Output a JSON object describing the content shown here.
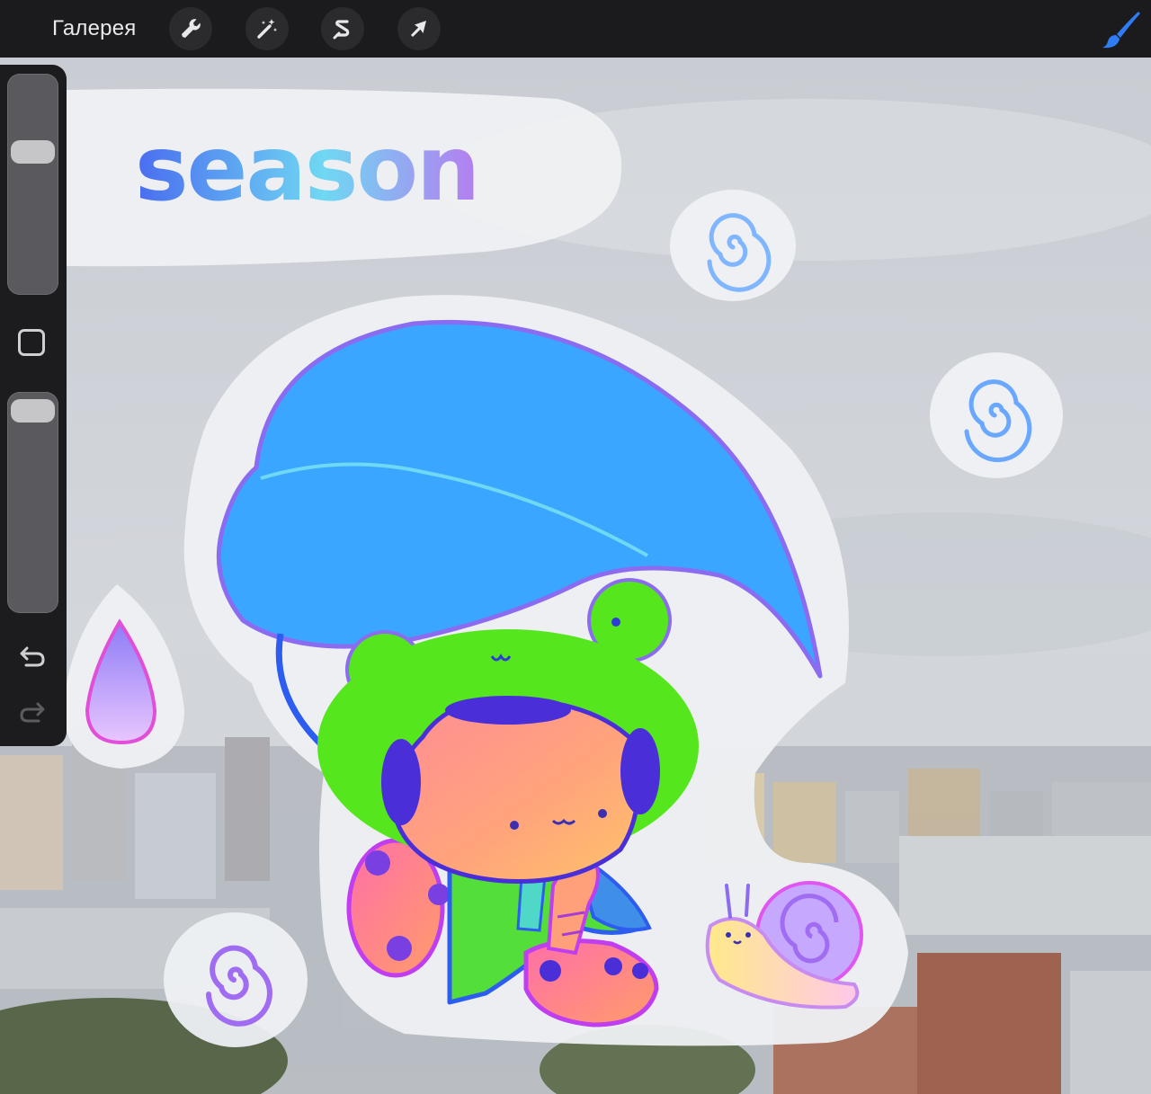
{
  "toolbar": {
    "gallery_label": "Галерея",
    "tools": [
      {
        "name": "actions",
        "icon": "wrench-icon"
      },
      {
        "name": "adjustments",
        "icon": "magic-wand-icon"
      },
      {
        "name": "selection",
        "icon": "selection-s-icon"
      },
      {
        "name": "transform",
        "icon": "arrow-cursor-icon"
      }
    ],
    "brush_icon": "brush-icon",
    "brush_color": "#2f7df6"
  },
  "sidebar": {
    "brush_size_level": 0.67,
    "opacity_level": 0.02,
    "modifier_icon": "square-modifier-icon",
    "undo_icon": "undo-icon",
    "redo_icon": "redo-icon",
    "redo_enabled": false
  },
  "canvas": {
    "lettering": "season",
    "colors": {
      "sky": "#cfd3d8",
      "sticker_border": "#eef0f3",
      "leaf": "#3aa6ff",
      "frog_hat": "#55e61e",
      "face": "#ff9f7a",
      "outline": "#3b40e6",
      "snail_shell": "#c6a8ff"
    }
  }
}
